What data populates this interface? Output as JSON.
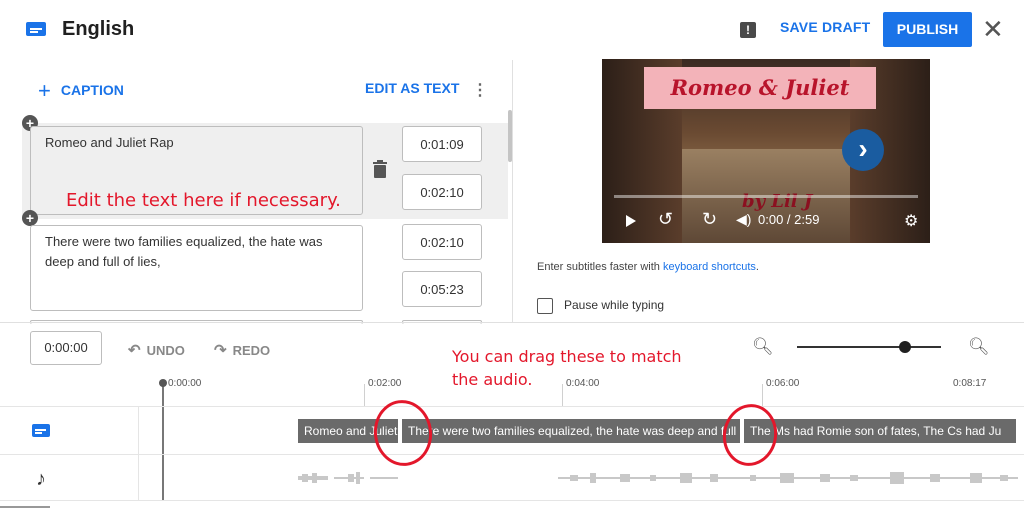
{
  "header": {
    "title": "English",
    "save_draft": "SAVE DRAFT",
    "publish": "PUBLISH",
    "close": "✕",
    "feedback_icon": "!"
  },
  "editor": {
    "add_caption": "CAPTION",
    "edit_as_text": "EDIT AS TEXT",
    "captions": [
      {
        "text": "Romeo and Juliet Rap",
        "start": "0:01:09",
        "end": "0:02:10"
      },
      {
        "text": "There were two families equalized, the hate was deep and full of lies,",
        "start": "0:02:10",
        "end": "0:05:23"
      }
    ]
  },
  "annotations": {
    "edit_hint": "Edit the text here if necessary.",
    "drag_hint_1": "You can drag these to match",
    "drag_hint_2": "the audio."
  },
  "video": {
    "title_text": "Romeo & Juliet",
    "subtitle_text": "by Lil J",
    "time": "0:00 / 2:59"
  },
  "options": {
    "shortcut_prefix": "Enter subtitles faster with ",
    "shortcut_link": "keyboard shortcuts",
    "shortcut_suffix": ".",
    "pause_while_typing": "Pause while typing"
  },
  "timeline": {
    "current_time": "0:00:00",
    "undo": "UNDO",
    "redo": "REDO",
    "ticks": [
      "0:00:00",
      "0:02:00",
      "0:04:00",
      "0:06:00",
      "0:08:17"
    ],
    "segments": [
      "Romeo and Juliet Rap",
      "There were two families equalized, the hate was deep and full of lies,",
      "The Ms had Romie son of fates, The Cs had Ju"
    ]
  },
  "colors": {
    "accent": "#1a73e8",
    "annotation": "#e3172b"
  }
}
